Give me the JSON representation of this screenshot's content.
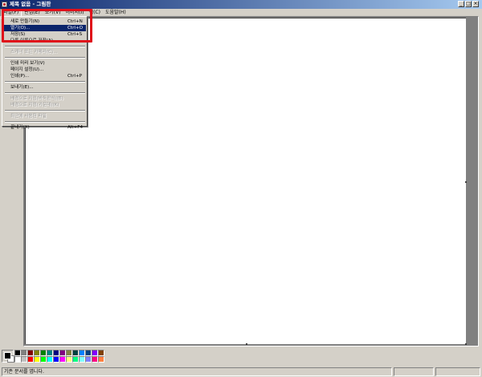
{
  "window": {
    "title": "제목 없음 - 그림판",
    "min_label": "_",
    "max_label": "□",
    "close_label": "×"
  },
  "menubar": [
    {
      "label": "파일(F)"
    },
    {
      "label": "편집(E)"
    },
    {
      "label": "보기(V)"
    },
    {
      "label": "이미지(I)"
    },
    {
      "label": "색(C)"
    },
    {
      "label": "도움말(H)"
    }
  ],
  "file_menu": [
    {
      "label": "새로 만들기(N)",
      "shortcut": "Ctrl+N",
      "state": "normal"
    },
    {
      "label": "열기(O)...",
      "shortcut": "Ctrl+O",
      "state": "selected"
    },
    {
      "label": "저장(S)",
      "shortcut": "Ctrl+S",
      "state": "normal"
    },
    {
      "label": "다른 이름으로 저장(A)...",
      "shortcut": "",
      "state": "normal"
    },
    {
      "separator": true
    },
    {
      "label": "스캐너 또는 카메라(C)...",
      "shortcut": "",
      "state": "disabled"
    },
    {
      "separator": true
    },
    {
      "label": "인쇄 미리 보기(V)",
      "shortcut": "",
      "state": "normal"
    },
    {
      "label": "페이지 설정(U)...",
      "shortcut": "",
      "state": "normal"
    },
    {
      "label": "인쇄(P)...",
      "shortcut": "Ctrl+P",
      "state": "normal"
    },
    {
      "separator": true
    },
    {
      "label": "보내기(E)...",
      "shortcut": "",
      "state": "normal"
    },
    {
      "separator": true
    },
    {
      "label": "배경으로 지정(바둑판식)(B)",
      "shortcut": "",
      "state": "disabled"
    },
    {
      "label": "배경으로 지정(가운데)(K)",
      "shortcut": "",
      "state": "disabled"
    },
    {
      "separator": true
    },
    {
      "label": "최근에 사용한 파일",
      "shortcut": "",
      "state": "disabled"
    },
    {
      "separator": true
    },
    {
      "label": "끝내기(X)",
      "shortcut": "Alt+F4",
      "state": "normal"
    }
  ],
  "palette": {
    "foreground": "#000000",
    "background": "#ffffff",
    "colors_top": [
      "#000000",
      "#808080",
      "#800000",
      "#808000",
      "#008000",
      "#008080",
      "#000080",
      "#800080",
      "#808040",
      "#004040",
      "#0080ff",
      "#004080",
      "#8000ff",
      "#804000"
    ],
    "colors_bottom": [
      "#ffffff",
      "#c0c0c0",
      "#ff0000",
      "#ffff00",
      "#00ff00",
      "#00ffff",
      "#0000ff",
      "#ff00ff",
      "#ffff80",
      "#00ff80",
      "#80ffff",
      "#8080ff",
      "#ff0080",
      "#ff8040"
    ]
  },
  "status": {
    "message": "기존 문서를 엽니다."
  },
  "highlight_color": "#e0101a"
}
